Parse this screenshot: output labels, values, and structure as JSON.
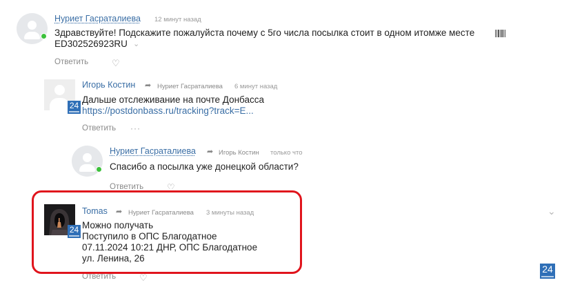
{
  "comments": [
    {
      "author": "Нуриет Гасраталиева",
      "time": "12 минут назад",
      "text_line1": "Здравствуйте! Подскажите пожалуйста почему с 5го числа посылка стоит в одном итомже месте",
      "text_line2": "ED302526923RU",
      "reply_label": "Ответить",
      "online": true
    },
    {
      "author": "Игорь Костин",
      "reply_to": "Нуриет Гасраталиева",
      "time": "6 минут назад",
      "text_line1": "Дальше отслеживание на почте Донбасса",
      "link": "https://postdonbass.ru/tracking?track=E...",
      "reply_label": "Ответить",
      "more": "···",
      "badge": "24"
    },
    {
      "author": "Нуриет Гасраталиева",
      "reply_to": "Игорь Костин",
      "time": "только что",
      "text_line1": "Спасибо а посылка уже донецкой области?",
      "reply_label": "Ответить",
      "online": true
    },
    {
      "author": "Tomas",
      "reply_to": "Нуриет Гасраталиева",
      "time": "3 минуты назад",
      "lines": [
        "Можно получать",
        "Поступило в ОПС Благодатное",
        "07.11.2024 10:21 ДНР, ОПС Благодатное",
        "ул. Ленина, 26"
      ],
      "reply_label": "Ответить",
      "badge": "24"
    }
  ],
  "corner_badge": "24",
  "colors": {
    "author": "#3a6ea5",
    "highlight": "#e0141c",
    "badge": "#2f6fb7",
    "online": "#3cc13b"
  },
  "icons": [
    "user-avatar-icon",
    "reply-arrow-icon",
    "heart-icon",
    "barcode-icon",
    "chevron-down-icon",
    "more-dots-icon"
  ]
}
